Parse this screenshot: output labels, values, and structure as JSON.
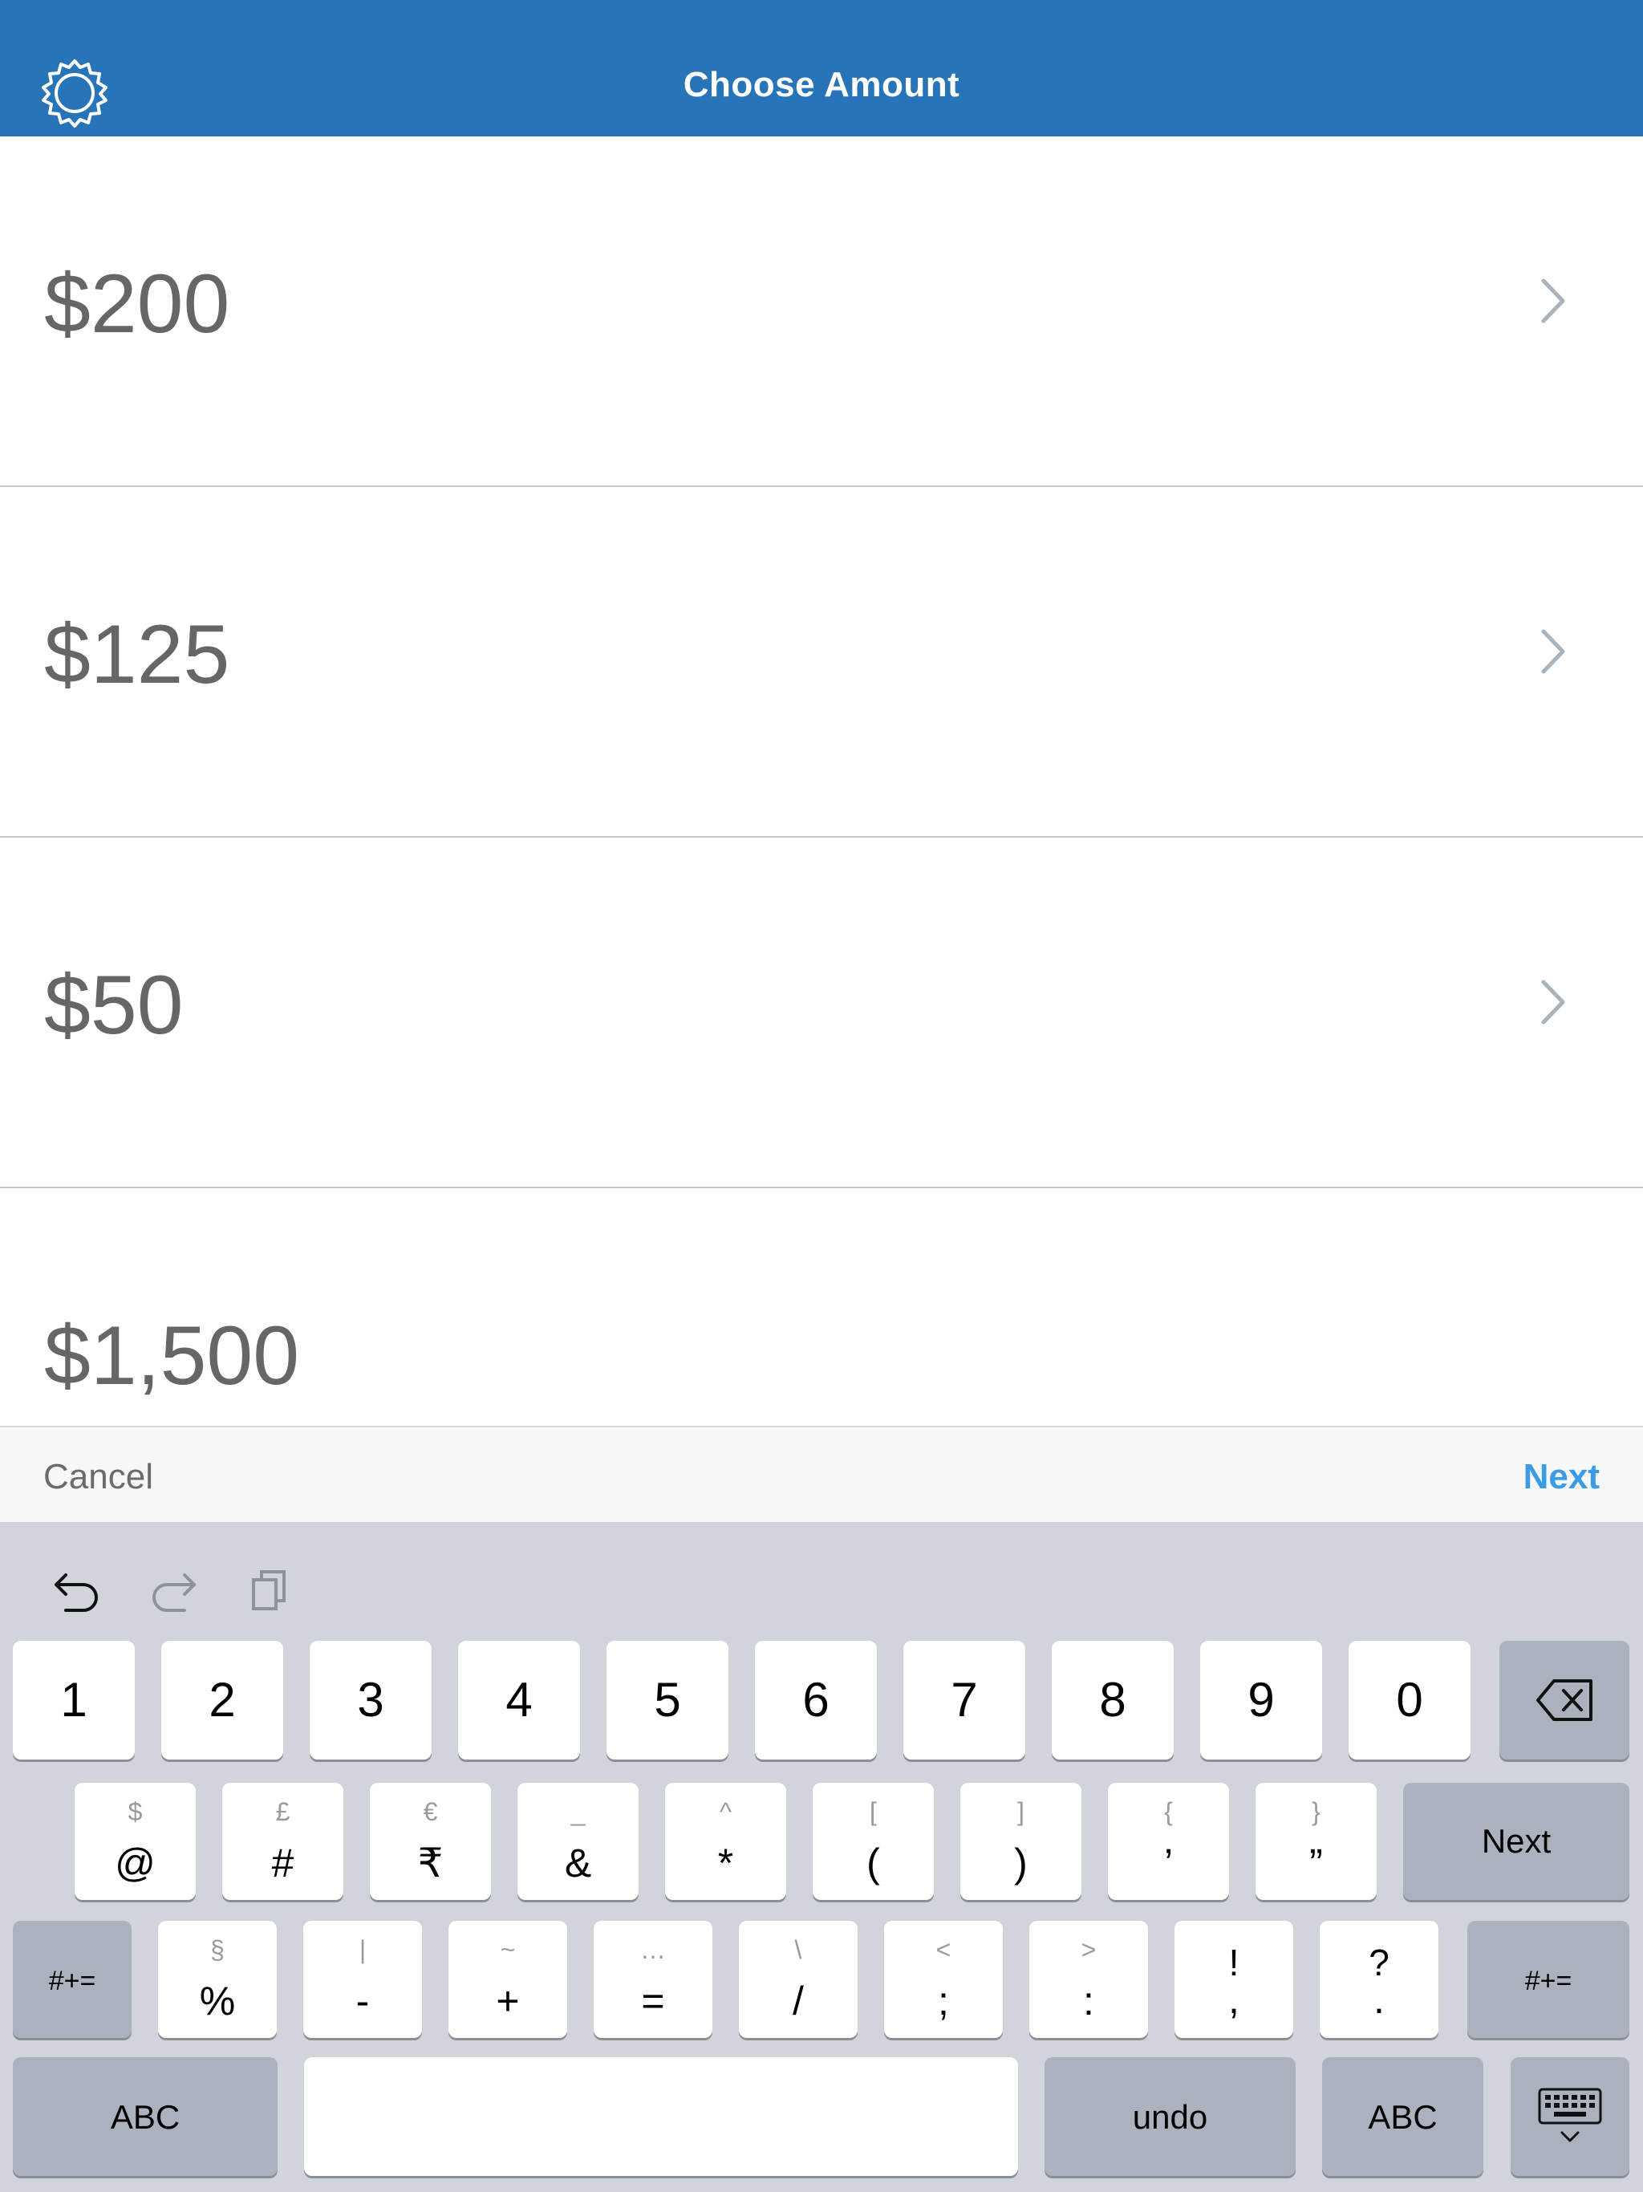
{
  "header": {
    "title": "Choose Amount",
    "settings_icon": "gear-icon",
    "color": "#2874b9"
  },
  "amounts": [
    "$200",
    "$125",
    "$50",
    "$1,500"
  ],
  "accessory": {
    "cancel": "Cancel",
    "next": "Next",
    "next_color": "#3a9be6"
  },
  "keyboard": {
    "tools": [
      "undo-arrow-icon",
      "redo-arrow-icon",
      "paste-icon"
    ],
    "row1": [
      "1",
      "2",
      "3",
      "4",
      "5",
      "6",
      "7",
      "8",
      "9",
      "0"
    ],
    "row2": [
      {
        "main": "@",
        "sub": "$"
      },
      {
        "main": "#",
        "sub": "£"
      },
      {
        "main": "₹",
        "sub": "€"
      },
      {
        "main": "&",
        "sub": "_"
      },
      {
        "main": "*",
        "sub": "^"
      },
      {
        "main": "(",
        "sub": "["
      },
      {
        "main": ")",
        "sub": "]"
      },
      {
        "main": "’",
        "sub": "{"
      },
      {
        "main": "”",
        "sub": "}"
      }
    ],
    "row2_action": "Next",
    "row3": [
      {
        "main": "%",
        "sub": "§"
      },
      {
        "main": "-",
        "sub": "|"
      },
      {
        "main": "+",
        "sub": "~"
      },
      {
        "main": "=",
        "sub": "…"
      },
      {
        "main": "/",
        "sub": "\\"
      },
      {
        "main": ";",
        "sub": "<"
      },
      {
        "main": ":",
        "sub": ">"
      },
      {
        "main": ",",
        "sub": "!"
      },
      {
        "main": ".",
        "sub": "?"
      }
    ],
    "row3_left": "#+=",
    "row3_right": "#+=",
    "row4": {
      "abc_left": "ABC",
      "space": "",
      "undo": "undo",
      "abc_right": "ABC",
      "dismiss_icon": "keyboard-dismiss-icon"
    }
  }
}
